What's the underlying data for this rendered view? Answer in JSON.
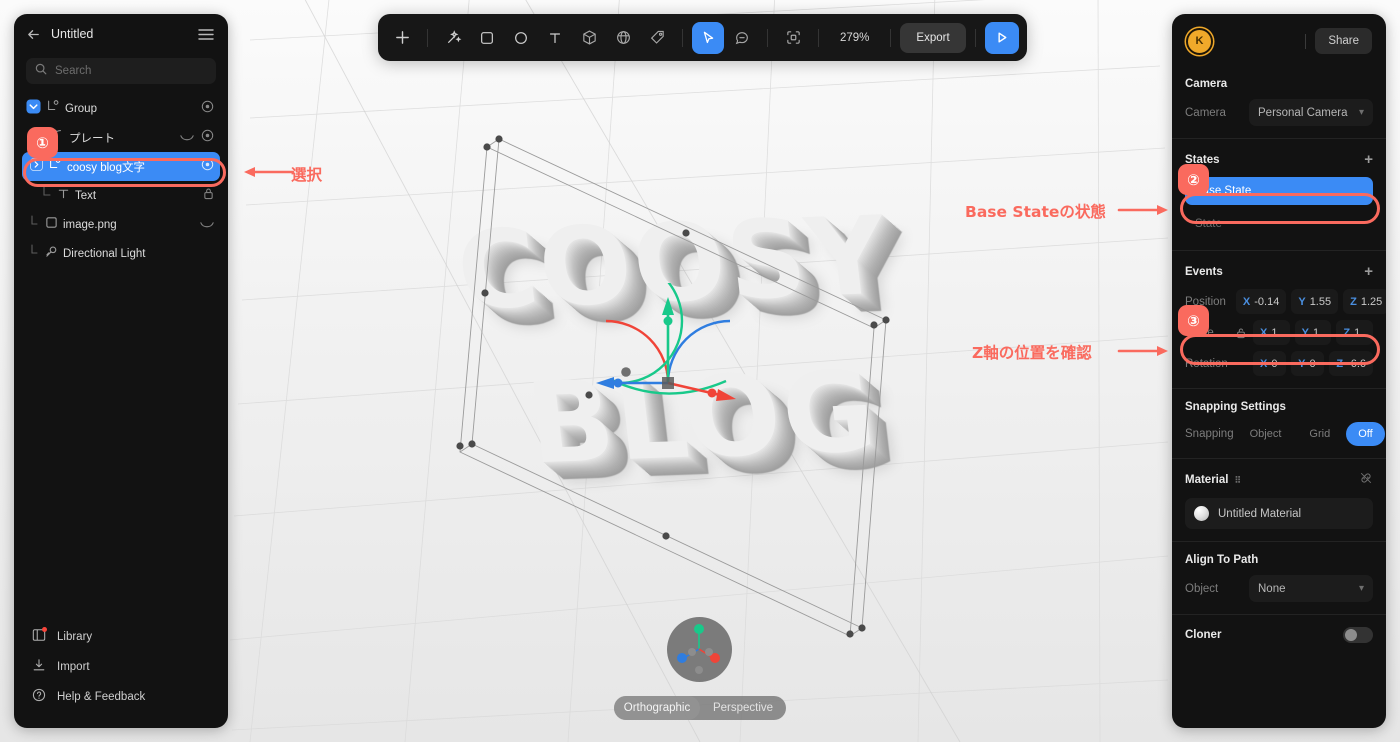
{
  "app": {
    "left_panel": {
      "title": "Untitled",
      "back_icon": "arrow-left-icon",
      "menu_icon": "hamburger-menu-icon",
      "search": {
        "placeholder": "Search",
        "icon": "search-icon"
      },
      "layers": [
        {
          "name": "Group",
          "icon": "group-axis-icon",
          "indent": 0,
          "checkbox": true,
          "chevron": "down",
          "visibility": "eye-icon",
          "curve": false,
          "selected": false,
          "locked": false
        },
        {
          "name": "プレート",
          "icon": "plate-curve-icon",
          "indent": 1,
          "checkbox": false,
          "chevron": "none",
          "visibility": "eye-icon",
          "curve": true,
          "selected": false,
          "locked": false
        },
        {
          "name": "coosy blog文字",
          "icon": "group-axis-icon",
          "indent": 1,
          "checkbox": false,
          "chevron": "right",
          "visibility": "eye-icon",
          "curve": false,
          "selected": true,
          "locked": false
        },
        {
          "name": "Text",
          "icon": "text-t-icon",
          "indent": 2,
          "checkbox": false,
          "chevron": "none",
          "visibility": "none",
          "curve": false,
          "selected": false,
          "locked": true
        },
        {
          "name": "image.png",
          "icon": "image-square-icon",
          "indent": 1,
          "checkbox": false,
          "chevron": "none",
          "visibility": "none",
          "curve": true,
          "selected": false,
          "locked": false
        },
        {
          "name": "Directional Light",
          "icon": "directional-light-icon",
          "indent": 1,
          "checkbox": false,
          "chevron": "none",
          "visibility": "none",
          "curve": false,
          "selected": false,
          "locked": false
        }
      ],
      "footer": [
        {
          "label": "Library",
          "icon": "library-icon",
          "badge": true
        },
        {
          "label": "Import",
          "icon": "import-download-icon",
          "badge": false
        },
        {
          "label": "Help & Feedback",
          "icon": "help-question-icon",
          "badge": false
        }
      ]
    },
    "toolbar": {
      "tools": [
        {
          "name": "add-icon",
          "glyph": "plus",
          "active": false
        },
        {
          "name": "magic-wand-icon",
          "glyph": "sparkle",
          "active": false
        },
        {
          "name": "rectangle-icon",
          "glyph": "square",
          "active": false
        },
        {
          "name": "ellipse-icon",
          "glyph": "circle",
          "active": false
        },
        {
          "name": "text-icon",
          "glyph": "letter-t",
          "active": false
        },
        {
          "name": "cube-3d-icon",
          "glyph": "cube",
          "active": false
        },
        {
          "name": "sphere-3d-icon",
          "glyph": "sphere",
          "active": false
        },
        {
          "name": "tag-icon",
          "glyph": "tag",
          "active": false
        },
        {
          "name": "select-cursor-icon",
          "glyph": "cursor",
          "active": true
        },
        {
          "name": "comment-icon",
          "glyph": "comment",
          "active": false
        },
        {
          "name": "frame-icon",
          "glyph": "frame",
          "active": false
        }
      ],
      "zoom_level": "279%",
      "export_label": "Export",
      "play_icon": "play-icon"
    },
    "right_panel": {
      "avatar_initial": "K",
      "share_label": "Share",
      "camera": {
        "section_title": "Camera",
        "field_label": "Camera",
        "value": "Personal Camera"
      },
      "states": {
        "section_title": "States",
        "add_icon": "plus-icon",
        "items": [
          {
            "label": "Base State",
            "active": true
          },
          {
            "label": "State",
            "active": false
          }
        ]
      },
      "events": {
        "section_title": "Events",
        "add_icon": "plus-icon"
      },
      "transform": [
        {
          "label": "Position",
          "lock": false,
          "x": "-0.14",
          "y": "1.55",
          "z": "1.25"
        },
        {
          "label": "Scale",
          "lock": true,
          "x": "1",
          "y": "1",
          "z": "1"
        },
        {
          "label": "Rotation",
          "lock": false,
          "x": "0",
          "y": "0",
          "z": "-6.6"
        }
      ],
      "axis_labels": {
        "x": "X",
        "y": "Y",
        "z": "Z"
      },
      "snapping": {
        "section_title": "Snapping Settings",
        "field_label": "Snapping",
        "options": [
          {
            "label": "Object",
            "active": false
          },
          {
            "label": "Grid",
            "active": false
          },
          {
            "label": "Off",
            "active": true
          }
        ]
      },
      "material": {
        "section_title": "Material",
        "link_icon": "broken-link-icon",
        "name": "Untitled Material"
      },
      "align_to_path": {
        "section_title": "Align To Path",
        "field_label": "Object",
        "value": "None"
      },
      "cloner": {
        "section_title": "Cloner",
        "enabled": false
      }
    },
    "viewport": {
      "text_line_1": "COOSY",
      "text_line_2": "BLOG",
      "projection": [
        {
          "label": "Orthographic",
          "active": true
        },
        {
          "label": "Perspective",
          "active": false
        }
      ],
      "gizmo_name": "transform-gizmo",
      "orientation_widget_name": "orientation-gizmo"
    },
    "annotations": [
      {
        "number": "①",
        "text": "選択",
        "arrow": "left"
      },
      {
        "number": "②",
        "text": "Base Stateの状態",
        "arrow": "right"
      },
      {
        "number": "③",
        "text": "Z軸の位置を確認",
        "arrow": "right"
      }
    ],
    "colors": {
      "accent_blue": "#3b8bf5",
      "annotation_red": "#fa6a5e",
      "avatar_orange": "#f0a92a",
      "panel_bg": "#121212",
      "axis_x": "#2f7de0",
      "axis_y": "#18c98a",
      "axis_z": "#f04438"
    }
  }
}
